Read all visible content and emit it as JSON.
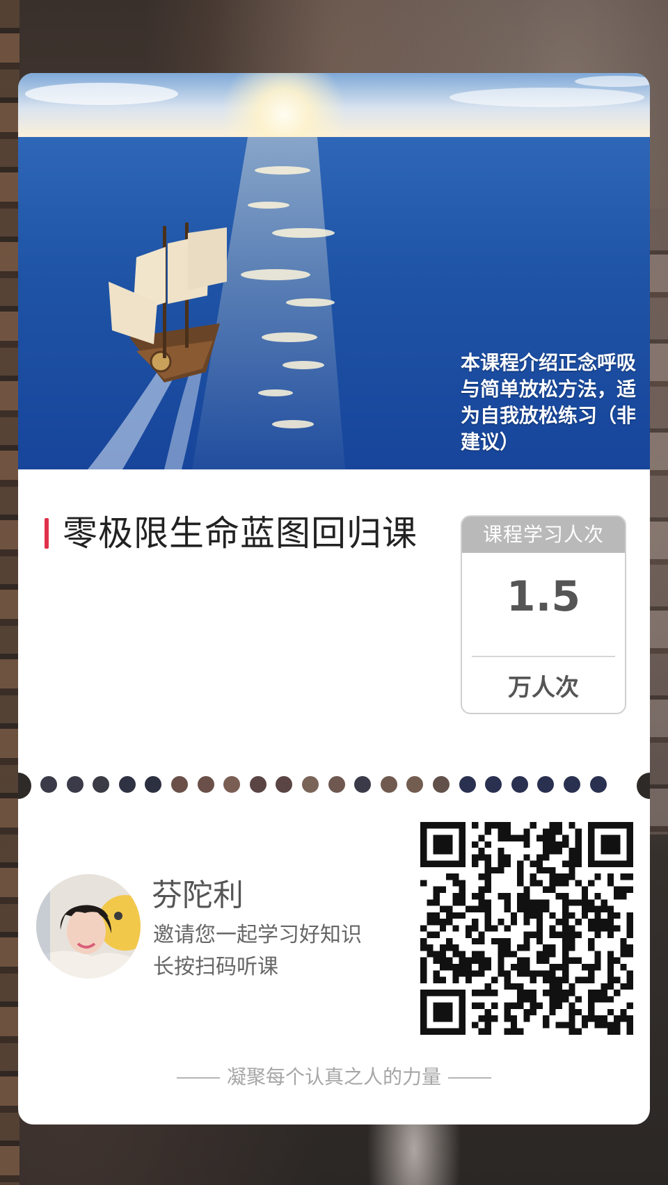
{
  "hero": {
    "caption": "本课程介绍正念呼吸\n与简单放松方法，适\n为自我放松练习（非\n建议）",
    "image_description": "ship-on-ocean-illustration"
  },
  "course": {
    "title": "零极限生命蓝图回归课"
  },
  "stats": {
    "header": "课程学习人次",
    "value": "1.5",
    "unit": "万人次"
  },
  "author": {
    "name": "芬陀利",
    "invite": "邀请您一起学习好知识",
    "hint": "长按扫码听课"
  },
  "footer": {
    "slogan": "凝聚每个认真之人的力量"
  },
  "colors": {
    "accent": "#e0304a",
    "stats_header": "#b9b9b9",
    "text_dark": "#222222",
    "text_muted": "#a6a6a6"
  },
  "icons": {
    "qr": "qr-code-icon",
    "avatar": "avatar-photo"
  }
}
